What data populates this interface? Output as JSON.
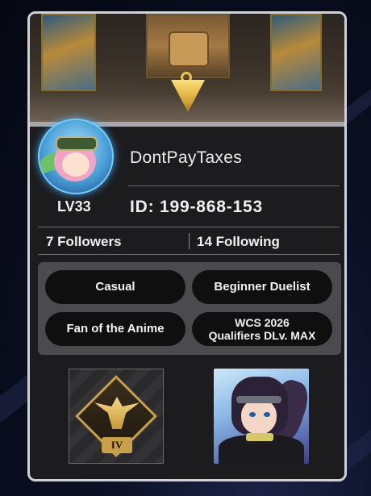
{
  "profile": {
    "name": "DontPayTaxes",
    "level": "LV33",
    "id": "ID: 199-868-153",
    "followers": "7 Followers",
    "following": "14 Following"
  },
  "tags": [
    "Casual",
    "Beginner Duelist",
    "Fan of the Anime",
    "WCS 2026\nQualifiers DLv. MAX"
  ],
  "rank": {
    "tier": "IV"
  },
  "icons": {
    "banner": "duel-room-mate-banner",
    "avatar": "character-avatar",
    "rank": "rank-emblem-icon",
    "profile_icon": "character-icon"
  },
  "colors": {
    "card_bg": "#1c1c1f",
    "tag_bg": "#0f0f10",
    "tags_panel": "#4b4b4f",
    "rank_gold": "#c9a04a",
    "avatar_glow": "#6fd0ff"
  }
}
